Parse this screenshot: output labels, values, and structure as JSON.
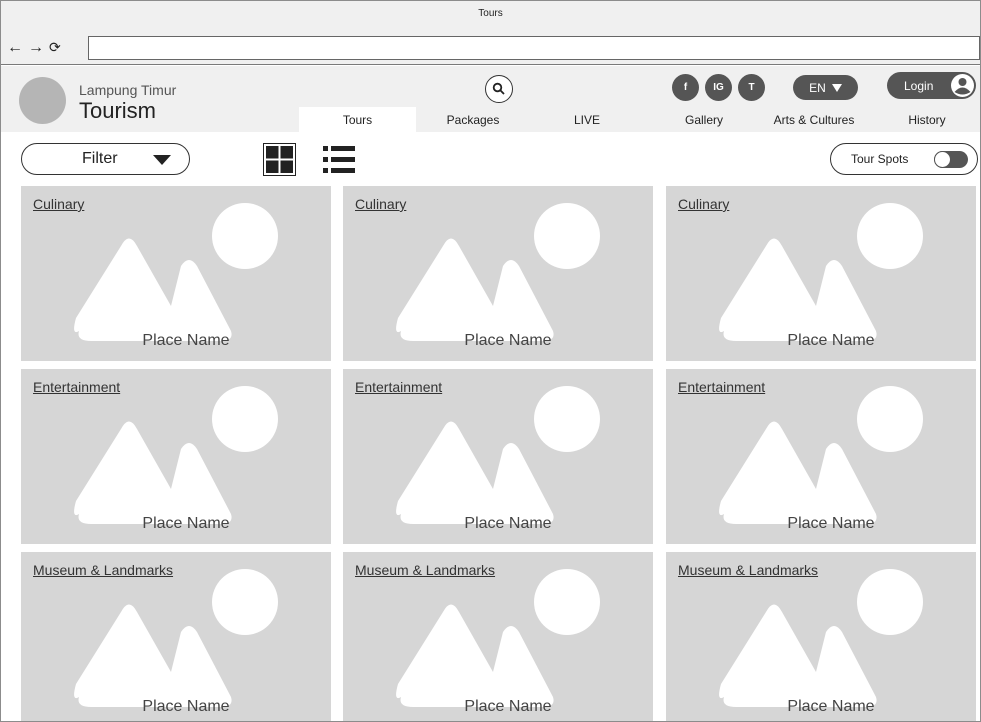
{
  "window": {
    "title": "Tours"
  },
  "browser": {
    "nav": {
      "back": "←",
      "forward": "→",
      "reload": "⟳"
    },
    "url": ""
  },
  "header": {
    "brand_small": "Lampung Timur",
    "brand_big": "Tourism",
    "social": {
      "facebook": "f",
      "instagram": "IG",
      "twitter": "T"
    },
    "lang": "EN",
    "login": "Login"
  },
  "tabs": [
    {
      "label": "Tours",
      "active": true
    },
    {
      "label": "Packages",
      "active": false
    },
    {
      "label": "LIVE",
      "active": false
    },
    {
      "label": "Gallery",
      "active": false
    },
    {
      "label": "Arts & Cultures",
      "active": false
    },
    {
      "label": "History",
      "active": false
    }
  ],
  "toolbar": {
    "filter_label": "Filter",
    "tour_spots_label": "Tour Spots"
  },
  "cards": [
    {
      "category": "Culinary",
      "place": "Place Name"
    },
    {
      "category": "Culinary",
      "place": "Place Name"
    },
    {
      "category": "Culinary",
      "place": "Place Name"
    },
    {
      "category": "Entertainment",
      "place": "Place Name"
    },
    {
      "category": "Entertainment",
      "place": "Place Name"
    },
    {
      "category": "Entertainment",
      "place": "Place Name"
    },
    {
      "category": "Museum & Landmarks",
      "place": "Place Name"
    },
    {
      "category": "Museum & Landmarks",
      "place": "Place Name"
    },
    {
      "category": "Museum & Landmarks",
      "place": "Place Name"
    }
  ]
}
